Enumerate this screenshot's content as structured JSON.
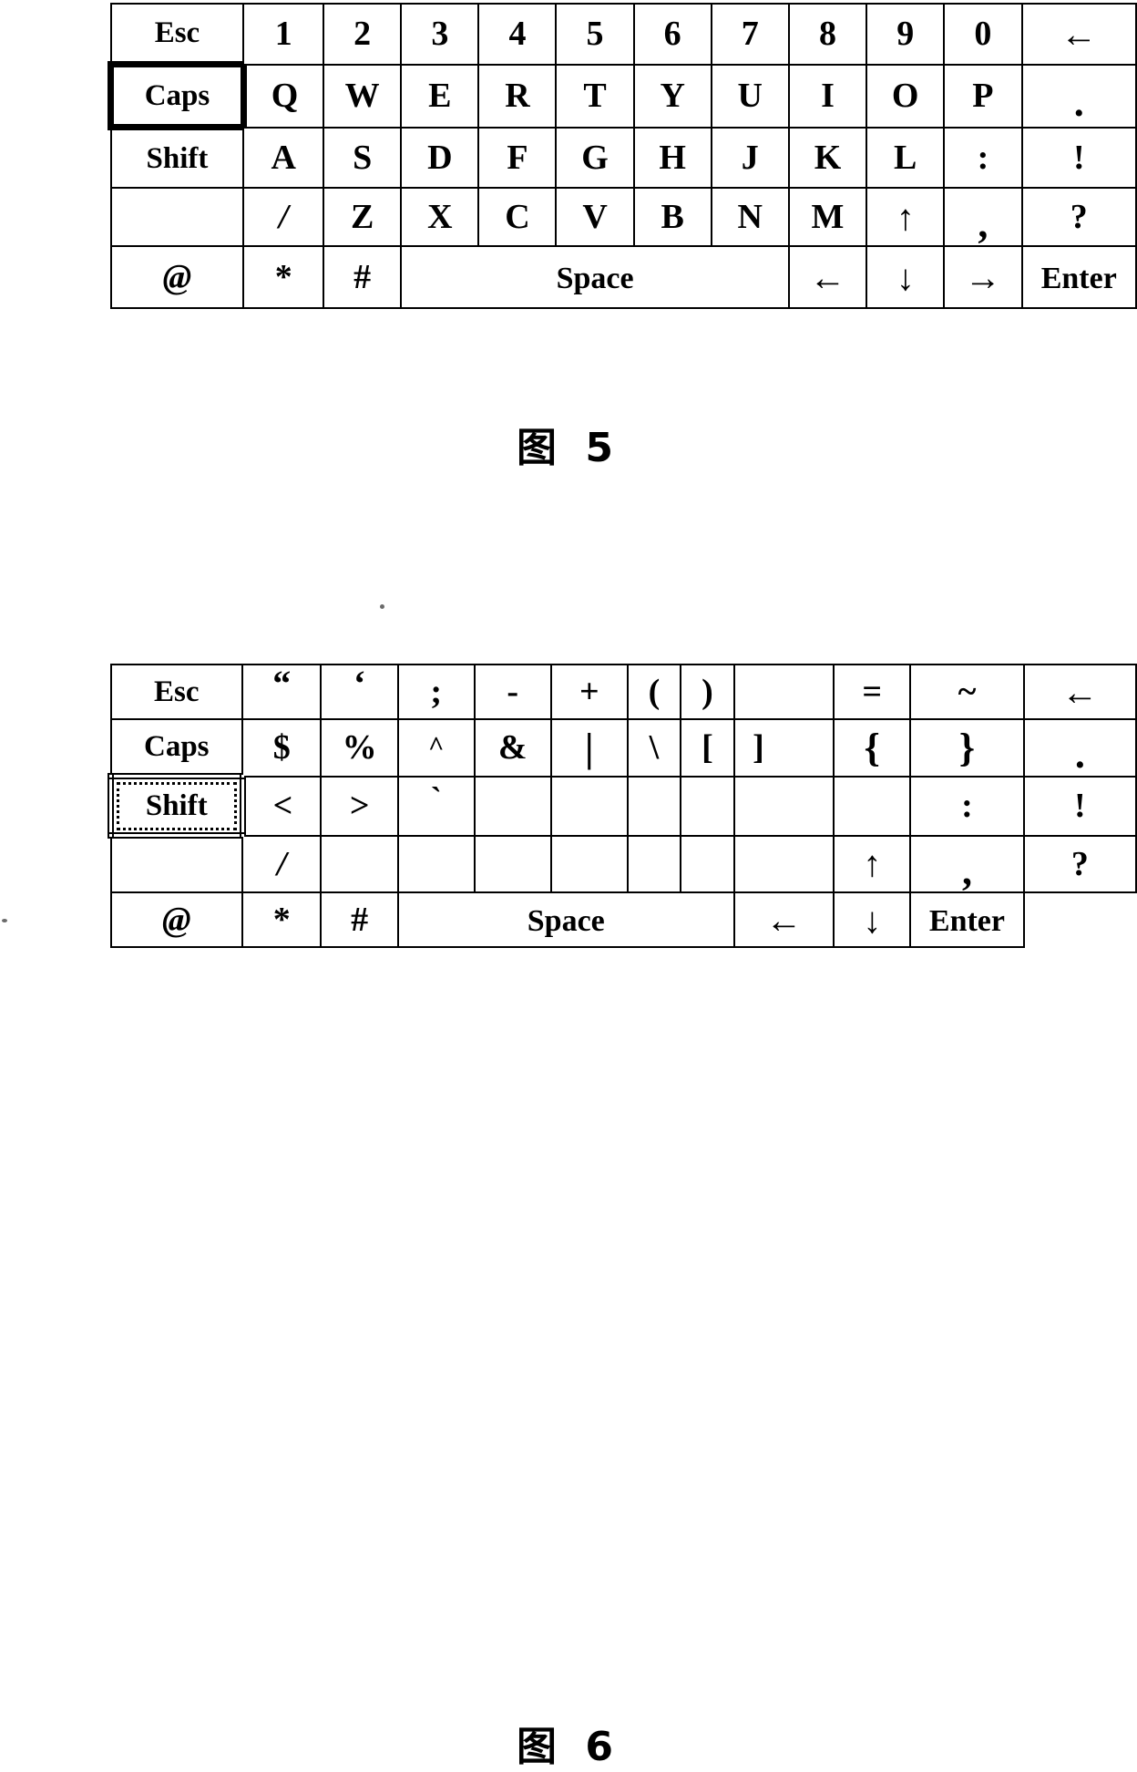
{
  "document": {
    "type": "patent-figure-sheet",
    "figures": [
      {
        "id": "figure-5",
        "caption": "图 5",
        "keyboard": {
          "name": "alphanumeric-keyboard",
          "active_key": "Caps",
          "active_key_style": "solid-thick-border",
          "columns": 12,
          "rows": [
            {
              "name": "number-row",
              "keys": [
                {
                  "label": "Esc",
                  "type": "modifier",
                  "span": 1
                },
                {
                  "label": "1",
                  "type": "key",
                  "span": 1
                },
                {
                  "label": "2",
                  "type": "key",
                  "span": 1
                },
                {
                  "label": "3",
                  "type": "key",
                  "span": 1
                },
                {
                  "label": "4",
                  "type": "key",
                  "span": 1
                },
                {
                  "label": "5",
                  "type": "key",
                  "span": 1
                },
                {
                  "label": "6",
                  "type": "key",
                  "span": 1
                },
                {
                  "label": "7",
                  "type": "key",
                  "span": 1
                },
                {
                  "label": "8",
                  "type": "key",
                  "span": 1
                },
                {
                  "label": "9",
                  "type": "key",
                  "span": 1
                },
                {
                  "label": "0",
                  "type": "key",
                  "span": 1
                },
                {
                  "label": "←",
                  "type": "backspace",
                  "span": 1
                }
              ]
            },
            {
              "name": "top-letter-row",
              "keys": [
                {
                  "label": "Caps",
                  "type": "modifier",
                  "span": 1,
                  "highlighted": true
                },
                {
                  "label": "Q",
                  "type": "key",
                  "span": 1
                },
                {
                  "label": "W",
                  "type": "key",
                  "span": 1
                },
                {
                  "label": "E",
                  "type": "key",
                  "span": 1
                },
                {
                  "label": "R",
                  "type": "key",
                  "span": 1
                },
                {
                  "label": "T",
                  "type": "key",
                  "span": 1
                },
                {
                  "label": "Y",
                  "type": "key",
                  "span": 1
                },
                {
                  "label": "U",
                  "type": "key",
                  "span": 1
                },
                {
                  "label": "I",
                  "type": "key",
                  "span": 1
                },
                {
                  "label": "O",
                  "type": "key",
                  "span": 1
                },
                {
                  "label": "P",
                  "type": "key",
                  "span": 1
                },
                {
                  "label": ".",
                  "type": "key",
                  "span": 1
                }
              ]
            },
            {
              "name": "home-letter-row",
              "keys": [
                {
                  "label": "Shift",
                  "type": "modifier",
                  "span": 1
                },
                {
                  "label": "A",
                  "type": "key",
                  "span": 1
                },
                {
                  "label": "S",
                  "type": "key",
                  "span": 1
                },
                {
                  "label": "D",
                  "type": "key",
                  "span": 1
                },
                {
                  "label": "F",
                  "type": "key",
                  "span": 1
                },
                {
                  "label": "G",
                  "type": "key",
                  "span": 1
                },
                {
                  "label": "H",
                  "type": "key",
                  "span": 1
                },
                {
                  "label": "J",
                  "type": "key",
                  "span": 1
                },
                {
                  "label": "K",
                  "type": "key",
                  "span": 1
                },
                {
                  "label": "L",
                  "type": "key",
                  "span": 1
                },
                {
                  "label": ":",
                  "type": "key",
                  "span": 1
                },
                {
                  "label": "!",
                  "type": "key",
                  "span": 1
                }
              ]
            },
            {
              "name": "bottom-letter-row",
              "keys": [
                {
                  "label": "",
                  "type": "blank",
                  "span": 1
                },
                {
                  "label": "/",
                  "type": "key",
                  "span": 1
                },
                {
                  "label": "Z",
                  "type": "key",
                  "span": 1
                },
                {
                  "label": "X",
                  "type": "key",
                  "span": 1
                },
                {
                  "label": "C",
                  "type": "key",
                  "span": 1
                },
                {
                  "label": "V",
                  "type": "key",
                  "span": 1
                },
                {
                  "label": "B",
                  "type": "key",
                  "span": 1
                },
                {
                  "label": "N",
                  "type": "key",
                  "span": 1
                },
                {
                  "label": "M",
                  "type": "key",
                  "span": 1
                },
                {
                  "label": "↑",
                  "type": "arrow-up",
                  "span": 1
                },
                {
                  "label": ",",
                  "type": "key",
                  "span": 1
                },
                {
                  "label": "?",
                  "type": "key",
                  "span": 1
                }
              ]
            },
            {
              "name": "space-row",
              "keys": [
                {
                  "label": "@",
                  "type": "key",
                  "span": 1
                },
                {
                  "label": "*",
                  "type": "key",
                  "span": 1
                },
                {
                  "label": "#",
                  "type": "key",
                  "span": 1
                },
                {
                  "label": "Space",
                  "type": "space",
                  "span": 5
                },
                {
                  "label": "←",
                  "type": "arrow-left",
                  "span": 1
                },
                {
                  "label": "↓",
                  "type": "arrow-down",
                  "span": 1
                },
                {
                  "label": "→",
                  "type": "arrow-right",
                  "span": 1
                },
                {
                  "label": "Enter",
                  "type": "enter",
                  "span": 1
                }
              ]
            }
          ]
        }
      },
      {
        "id": "figure-6",
        "caption": "图 6",
        "keyboard": {
          "name": "symbol-keyboard",
          "active_key": "Shift",
          "active_key_style": "dotted-thick-border",
          "columns": 12,
          "rows": [
            {
              "name": "symbol-row-1",
              "keys": [
                {
                  "label": "Esc",
                  "type": "modifier",
                  "span": 1
                },
                {
                  "label": "“",
                  "type": "key",
                  "span": 1
                },
                {
                  "label": "‘",
                  "type": "key",
                  "span": 1
                },
                {
                  "label": ";",
                  "type": "key",
                  "span": 1
                },
                {
                  "label": "-",
                  "type": "key",
                  "span": 1
                },
                {
                  "label": "+",
                  "type": "key",
                  "span": 1
                },
                {
                  "label": "(",
                  "type": "key",
                  "span": 1
                },
                {
                  "label": ")",
                  "type": "key",
                  "span": 1
                },
                {
                  "label": "_",
                  "type": "key",
                  "span": 1
                },
                {
                  "label": "=",
                  "type": "key",
                  "span": 1
                },
                {
                  "label": "~",
                  "type": "key",
                  "span": 1
                },
                {
                  "label": "←",
                  "type": "backspace",
                  "span": 1
                }
              ]
            },
            {
              "name": "symbol-row-2",
              "keys": [
                {
                  "label": "Caps",
                  "type": "modifier",
                  "span": 1
                },
                {
                  "label": "$",
                  "type": "key",
                  "span": 1
                },
                {
                  "label": "%",
                  "type": "key",
                  "span": 1
                },
                {
                  "label": "^",
                  "type": "key",
                  "span": 1
                },
                {
                  "label": "&",
                  "type": "key",
                  "span": 1
                },
                {
                  "label": "|",
                  "type": "key",
                  "span": 1
                },
                {
                  "label": "\\",
                  "type": "key",
                  "span": 1
                },
                {
                  "label": "[",
                  "type": "key",
                  "span": 1
                },
                {
                  "label": "]",
                  "type": "key",
                  "span": 1
                },
                {
                  "label": "{",
                  "type": "key",
                  "span": 1
                },
                {
                  "label": "}",
                  "type": "key",
                  "span": 1
                },
                {
                  "label": ".",
                  "type": "key",
                  "span": 1
                }
              ]
            },
            {
              "name": "symbol-row-3",
              "keys": [
                {
                  "label": "Shift",
                  "type": "modifier",
                  "span": 1,
                  "highlighted": true
                },
                {
                  "label": "<",
                  "type": "key",
                  "span": 1
                },
                {
                  "label": ">",
                  "type": "key",
                  "span": 1
                },
                {
                  "label": "`",
                  "type": "key",
                  "span": 1
                },
                {
                  "label": "",
                  "type": "blank",
                  "span": 1
                },
                {
                  "label": "",
                  "type": "blank",
                  "span": 1
                },
                {
                  "label": "",
                  "type": "blank",
                  "span": 1
                },
                {
                  "label": "",
                  "type": "blank",
                  "span": 1
                },
                {
                  "label": "",
                  "type": "blank",
                  "span": 1
                },
                {
                  "label": "",
                  "type": "blank",
                  "span": 1
                },
                {
                  "label": ":",
                  "type": "key",
                  "span": 1
                },
                {
                  "label": "!",
                  "type": "key",
                  "span": 1
                }
              ]
            },
            {
              "name": "symbol-row-4",
              "keys": [
                {
                  "label": "",
                  "type": "blank",
                  "span": 1
                },
                {
                  "label": "/",
                  "type": "key",
                  "span": 1
                },
                {
                  "label": "",
                  "type": "blank",
                  "span": 1
                },
                {
                  "label": "",
                  "type": "blank",
                  "span": 1
                },
                {
                  "label": "",
                  "type": "blank",
                  "span": 1
                },
                {
                  "label": "",
                  "type": "blank",
                  "span": 1
                },
                {
                  "label": "",
                  "type": "blank",
                  "span": 1
                },
                {
                  "label": "",
                  "type": "blank",
                  "span": 1
                },
                {
                  "label": "",
                  "type": "blank",
                  "span": 1
                },
                {
                  "label": "↑",
                  "type": "arrow-up",
                  "span": 1
                },
                {
                  "label": ",",
                  "type": "key",
                  "span": 1
                },
                {
                  "label": "?",
                  "type": "key",
                  "span": 1
                }
              ]
            },
            {
              "name": "space-row",
              "keys": [
                {
                  "label": "@",
                  "type": "key",
                  "span": 1
                },
                {
                  "label": "*",
                  "type": "key",
                  "span": 1
                },
                {
                  "label": "#",
                  "type": "key",
                  "span": 1
                },
                {
                  "label": "Space",
                  "type": "space",
                  "span": 5
                },
                {
                  "label": "←",
                  "type": "arrow-left",
                  "span": 1
                },
                {
                  "label": "↓",
                  "type": "arrow-down",
                  "span": 1
                },
                {
                  "label": "→",
                  "type": "arrow-right",
                  "span": 1
                },
                {
                  "label": "Enter",
                  "type": "enter",
                  "span": 1
                }
              ]
            }
          ]
        }
      }
    ]
  }
}
